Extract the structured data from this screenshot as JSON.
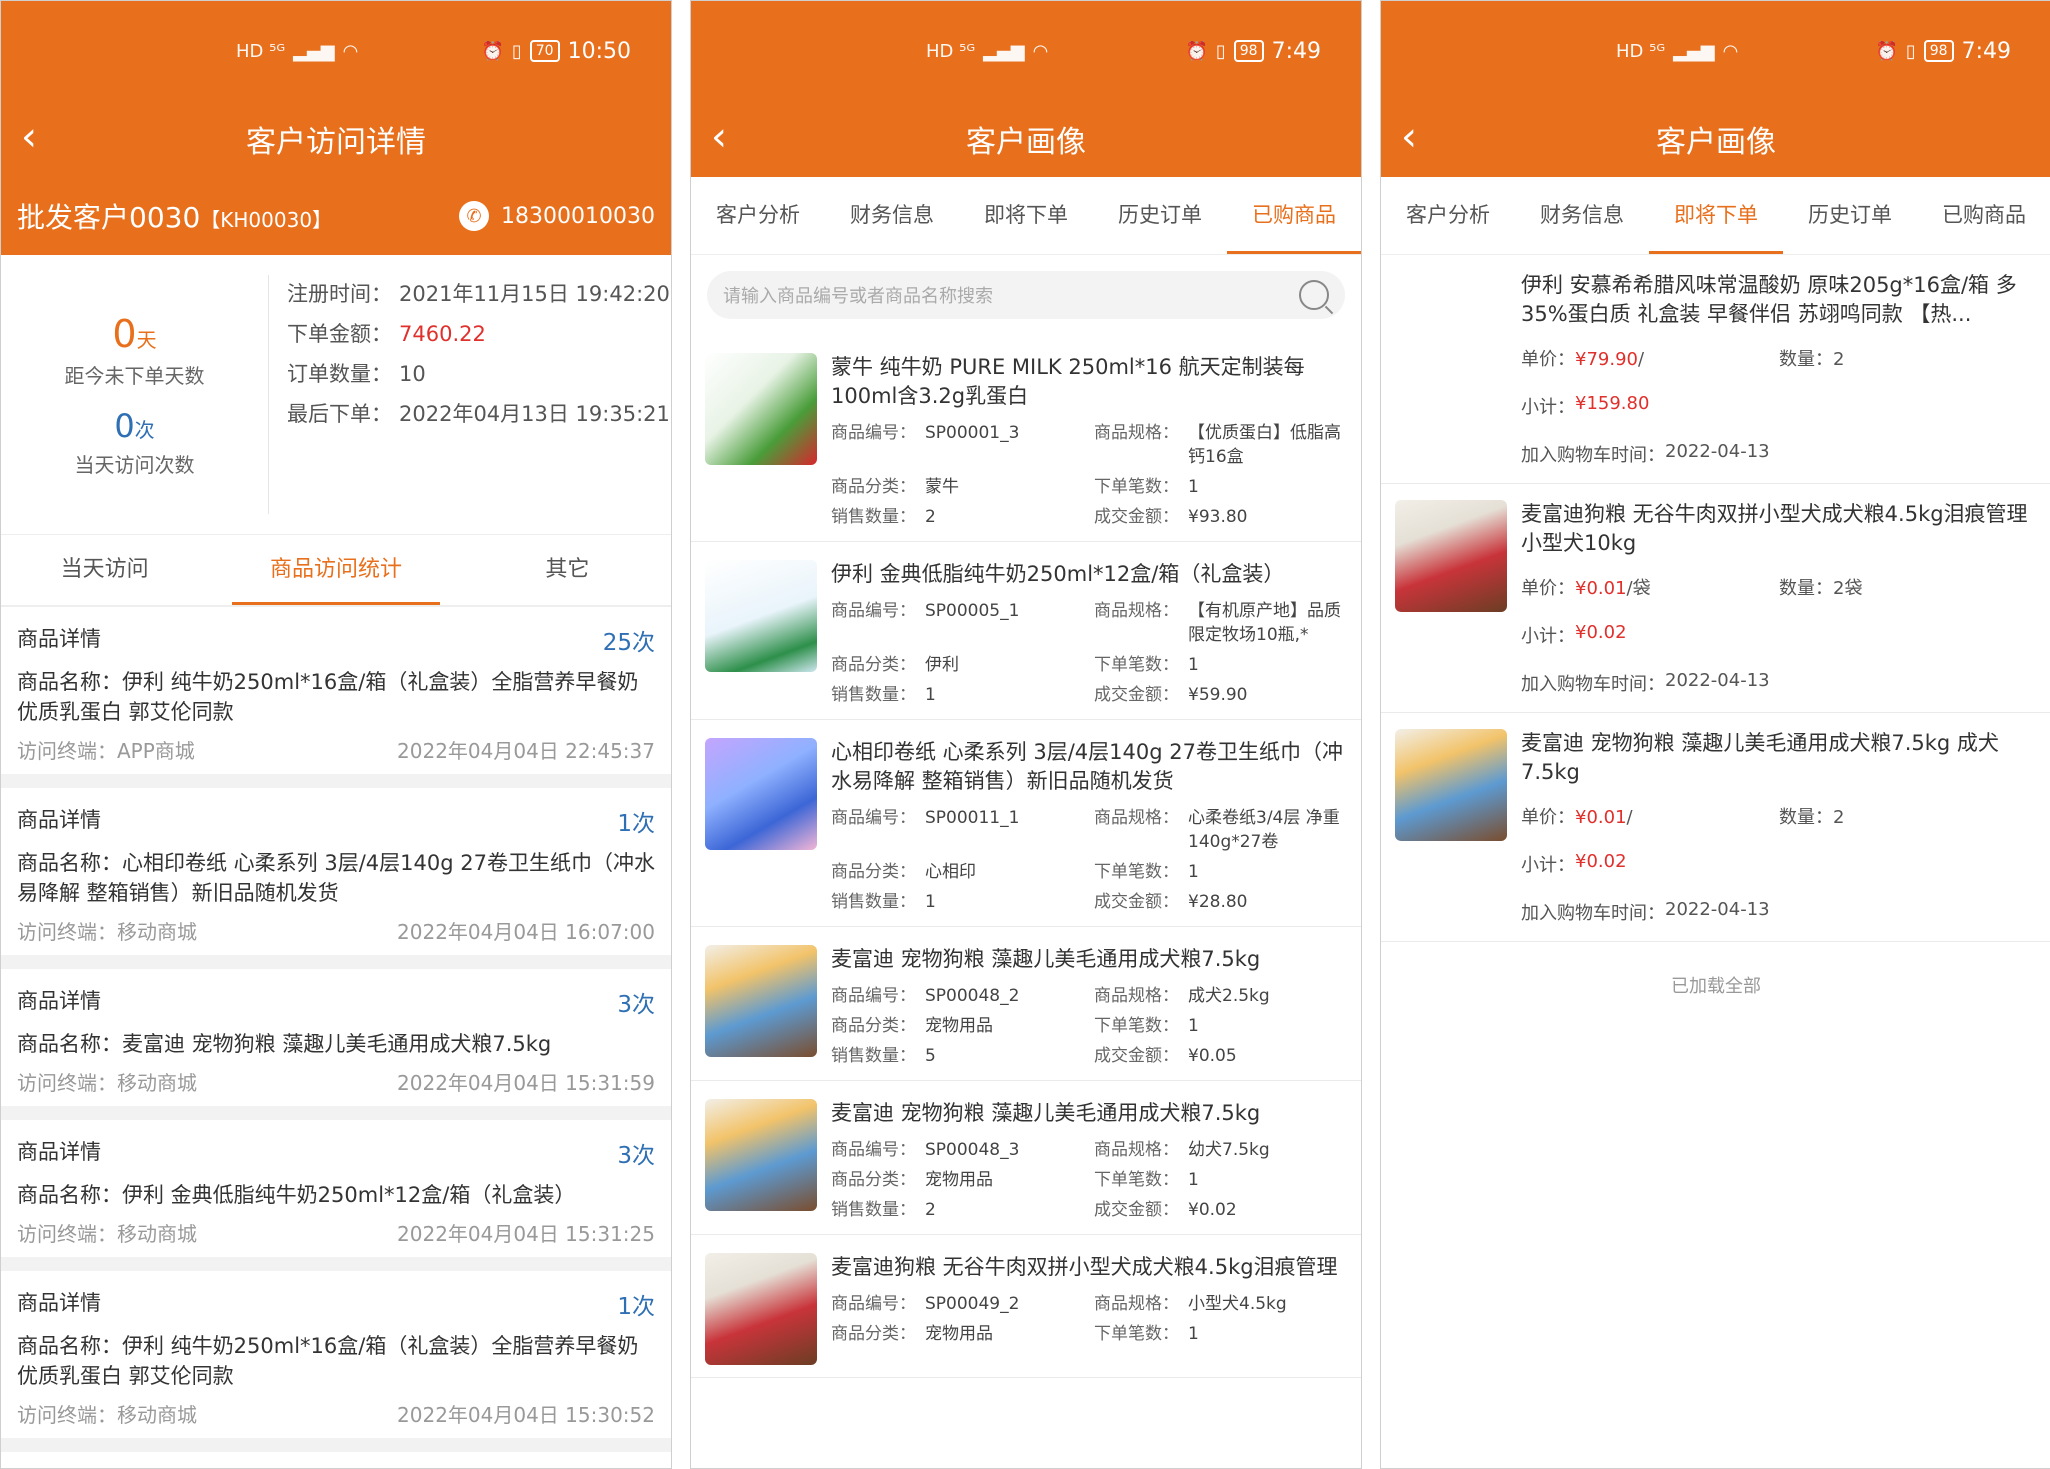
{
  "status": {
    "p1": {
      "battery": "70",
      "time": "10:50",
      "net": "HD ⁵ᴳ"
    },
    "p2": {
      "battery": "98",
      "time": "7:49",
      "net": "HD ⁵ᴳ"
    },
    "p3": {
      "battery": "98",
      "time": "7:49",
      "net": "HD ⁵ᴳ"
    }
  },
  "p1": {
    "title": "客户访问详情",
    "customer_name": "批发客户0030",
    "customer_code": "【KH00030】",
    "phone": "18300010030",
    "days_value": "0",
    "days_unit": "天",
    "days_label": "距今未下单天数",
    "visits_value": "0",
    "visits_unit": "次",
    "visits_label": "当天访问次数",
    "info": [
      {
        "k": "注册时间：",
        "v": "2021年11月15日 19:42:20"
      },
      {
        "k": "下单金额：",
        "v": "7460.22"
      },
      {
        "k": "订单数量：",
        "v": "10"
      },
      {
        "k": "最后下单：",
        "v": "2022年04月13日 19:35:21"
      }
    ],
    "tabs": [
      "当天访问",
      "商品访问统计",
      "其它"
    ],
    "visits": [
      {
        "title": "商品详情",
        "count": "25次",
        "name": "商品名称：伊利 纯牛奶250ml*16盒/箱（礼盒装）全脂营养早餐奶 优质乳蛋白 郭艾伦同款",
        "terminal": "访问终端：APP商城",
        "time": "2022年04月04日 22:45:37"
      },
      {
        "title": "商品详情",
        "count": "1次",
        "name": "商品名称：心相印卷纸 心柔系列 3层/4层140g 27卷卫生纸巾（冲水易降解 整箱销售）新旧品随机发货",
        "terminal": "访问终端：移动商城",
        "time": "2022年04月04日 16:07:00"
      },
      {
        "title": "商品详情",
        "count": "3次",
        "name": "商品名称：麦富迪 宠物狗粮 藻趣儿美毛通用成犬粮7.5kg",
        "terminal": "访问终端：移动商城",
        "time": "2022年04月04日 15:31:59"
      },
      {
        "title": "商品详情",
        "count": "3次",
        "name": "商品名称：伊利 金典低脂纯牛奶250ml*12盒/箱（礼盒装）",
        "terminal": "访问终端：移动商城",
        "time": "2022年04月04日 15:31:25"
      },
      {
        "title": "商品详情",
        "count": "1次",
        "name": "商品名称：伊利 纯牛奶250ml*16盒/箱（礼盒装）全脂营养早餐奶 优质乳蛋白 郭艾伦同款",
        "terminal": "访问终端：移动商城",
        "time": "2022年04月04日 15:30:52"
      }
    ]
  },
  "p2": {
    "title": "客户画像",
    "tabs": [
      "客户分析",
      "财务信息",
      "即将下单",
      "历史订单",
      "已购商品"
    ],
    "search_placeholder": "请输入商品编号或者商品名称搜索",
    "labels": {
      "code": "商品编号：",
      "spec": "商品规格：",
      "cat": "商品分类：",
      "orders": "下单笔数：",
      "qty": "销售数量：",
      "amount": "成交金额："
    },
    "products": [
      {
        "name": "蒙牛 纯牛奶 PURE MILK 250ml*16 航天定制装每100ml含3.2g乳蛋白",
        "code": "SP00001_3",
        "spec": "【优质蛋白】低脂高钙16盒",
        "cat": "蒙牛",
        "orders": "1",
        "qty": "2",
        "amount": "¥93.80"
      },
      {
        "name": "伊利 金典低脂纯牛奶250ml*12盒/箱（礼盒装）",
        "code": "SP00005_1",
        "spec": "【有机原产地】品质限定牧场10瓶,*",
        "cat": "伊利",
        "orders": "1",
        "qty": "1",
        "amount": "¥59.90"
      },
      {
        "name": "心相印卷纸 心柔系列 3层/4层140g 27卷卫生纸巾（冲水易降解 整箱销售）新旧品随机发货",
        "code": "SP00011_1",
        "spec": "心柔卷纸3/4层 净重140g*27卷",
        "cat": "心相印",
        "orders": "1",
        "qty": "1",
        "amount": "¥28.80"
      },
      {
        "name": "麦富迪 宠物狗粮 藻趣儿美毛通用成犬粮7.5kg",
        "code": "SP00048_2",
        "spec": "成犬2.5kg",
        "cat": "宠物用品",
        "orders": "1",
        "qty": "5",
        "amount": "¥0.05"
      },
      {
        "name": "麦富迪 宠物狗粮 藻趣儿美毛通用成犬粮7.5kg",
        "code": "SP00048_3",
        "spec": "幼犬7.5kg",
        "cat": "宠物用品",
        "orders": "1",
        "qty": "2",
        "amount": "¥0.02"
      },
      {
        "name": "麦富迪狗粮 无谷牛肉双拼小型犬成犬粮4.5kg泪痕管理",
        "code": "SP00049_2",
        "spec": "小型犬4.5kg",
        "cat": "宠物用品",
        "orders": "1",
        "qty": "",
        "amount": ""
      }
    ]
  },
  "p3": {
    "title": "客户画像",
    "tabs": [
      "客户分析",
      "财务信息",
      "即将下单",
      "历史订单",
      "已购商品"
    ],
    "labels": {
      "price": "单价：",
      "qty": "数量：",
      "subtotal": "小计：",
      "added": "加入购物车时间："
    },
    "items": [
      {
        "name": "伊利 安慕希希腊风味常温酸奶 原味205g*16盒/箱 多35%蛋白质 礼盒装 早餐伴侣 苏翊鸣同款 【热...",
        "price": "¥79.90",
        "unit": "/",
        "qty": "2",
        "subtotal": "¥159.80",
        "added": "2022-04-13"
      },
      {
        "name": "麦富迪狗粮 无谷牛肉双拼小型犬成犬粮4.5kg泪痕管理 小型犬10kg",
        "price": "¥0.01",
        "unit": "/袋",
        "qty": "2袋",
        "subtotal": "¥0.02",
        "added": "2022-04-13"
      },
      {
        "name": "麦富迪 宠物狗粮 藻趣儿美毛通用成犬粮7.5kg 成犬7.5kg",
        "price": "¥0.01",
        "unit": "/",
        "qty": "2",
        "subtotal": "¥0.02",
        "added": "2022-04-13"
      }
    ],
    "loaded_all": "已加载全部"
  },
  "icons": {
    "back": "chevron-left-icon",
    "phone": "phone-icon",
    "search": "search-icon"
  },
  "colors": {
    "accent": "#e8701d",
    "red": "#e0302c",
    "blue": "#2f6fb3"
  }
}
